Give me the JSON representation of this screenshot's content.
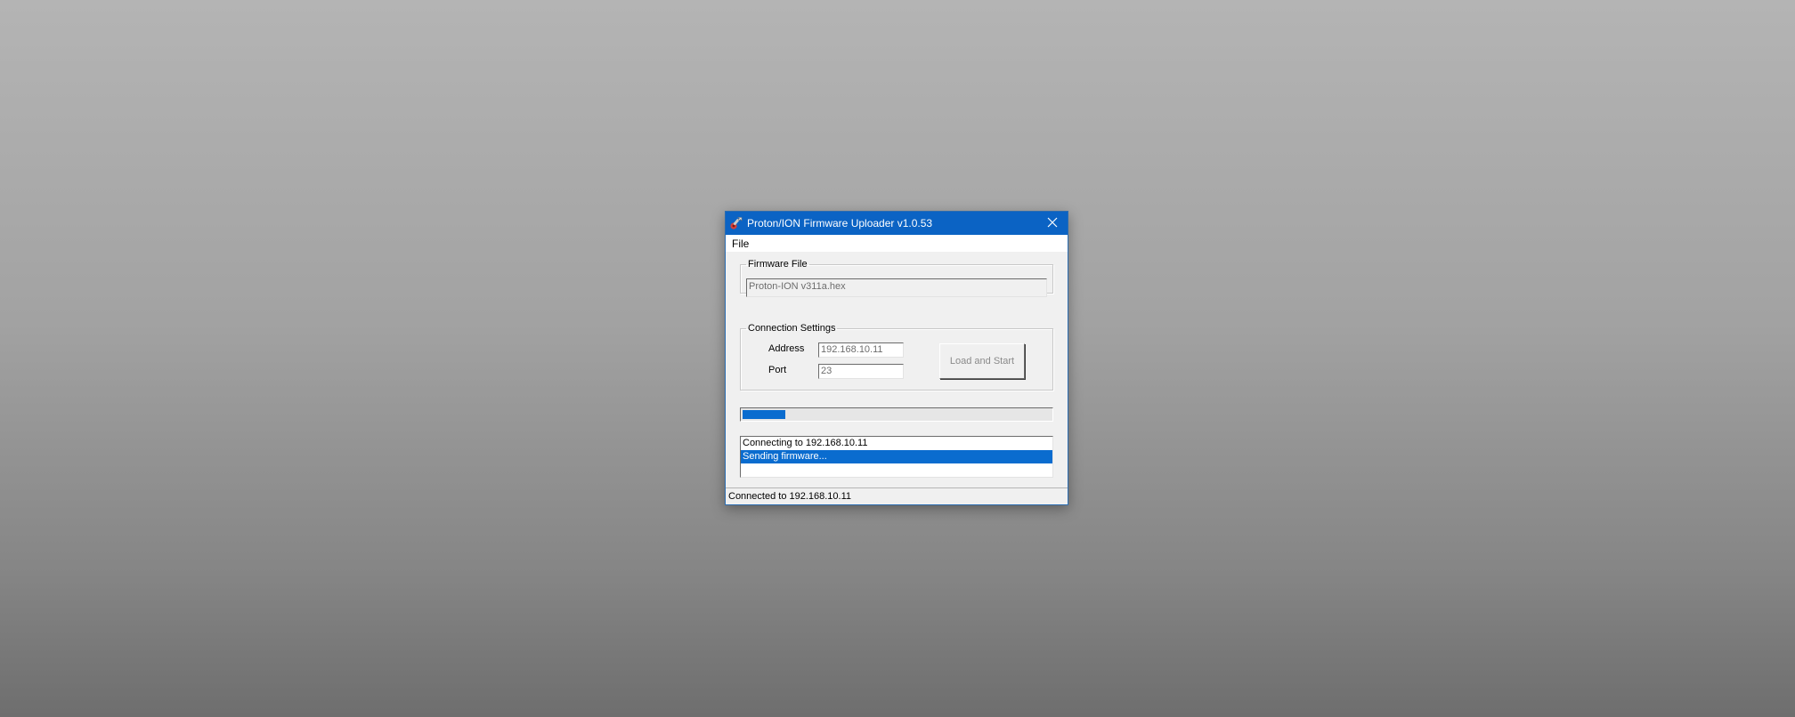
{
  "window": {
    "title": "Proton/ION Firmware Uploader v1.0.53",
    "app_icon": "wrench-app-icon",
    "close_icon": "close-icon"
  },
  "menu": {
    "items": [
      {
        "label": "File"
      }
    ]
  },
  "firmware": {
    "group_label": "Firmware File",
    "file_value": "Proton-ION v311a.hex"
  },
  "connection": {
    "group_label": "Connection Settings",
    "address_label": "Address",
    "address_value": "192.168.10.11",
    "port_label": "Port",
    "port_value": "23",
    "load_button_label": "Load and Start"
  },
  "progress": {
    "fraction": 0.14,
    "fill_color": "#0a6ccf"
  },
  "log": {
    "lines": [
      {
        "text": "Connecting to 192.168.10.11",
        "selected": false
      },
      {
        "text": "Sending firmware...",
        "selected": true
      }
    ]
  },
  "status": {
    "text": "Connected to 192.168.10.11"
  },
  "colors": {
    "titlebar": "#0b63c4",
    "selection": "#0a6ccf"
  }
}
